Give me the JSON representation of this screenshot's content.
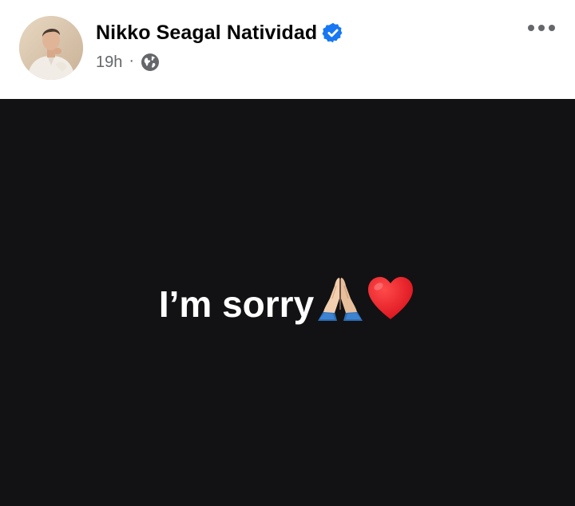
{
  "author": {
    "name": "Nikko Seagal Natividad",
    "verified": true,
    "avatar_icon": "profile-photo"
  },
  "meta": {
    "timestamp": "19h",
    "separator": "·",
    "audience_icon": "globe-icon"
  },
  "actions": {
    "more_icon": "more-options-icon"
  },
  "post": {
    "text": "I’m sorry",
    "emojis": [
      "folded-hands-emoji",
      "red-heart-emoji"
    ],
    "background_color": "#121214",
    "text_color": "#ffffff"
  },
  "colors": {
    "verified_blue": "#1877f2",
    "secondary_text": "#65676b",
    "primary_text": "#050505"
  }
}
